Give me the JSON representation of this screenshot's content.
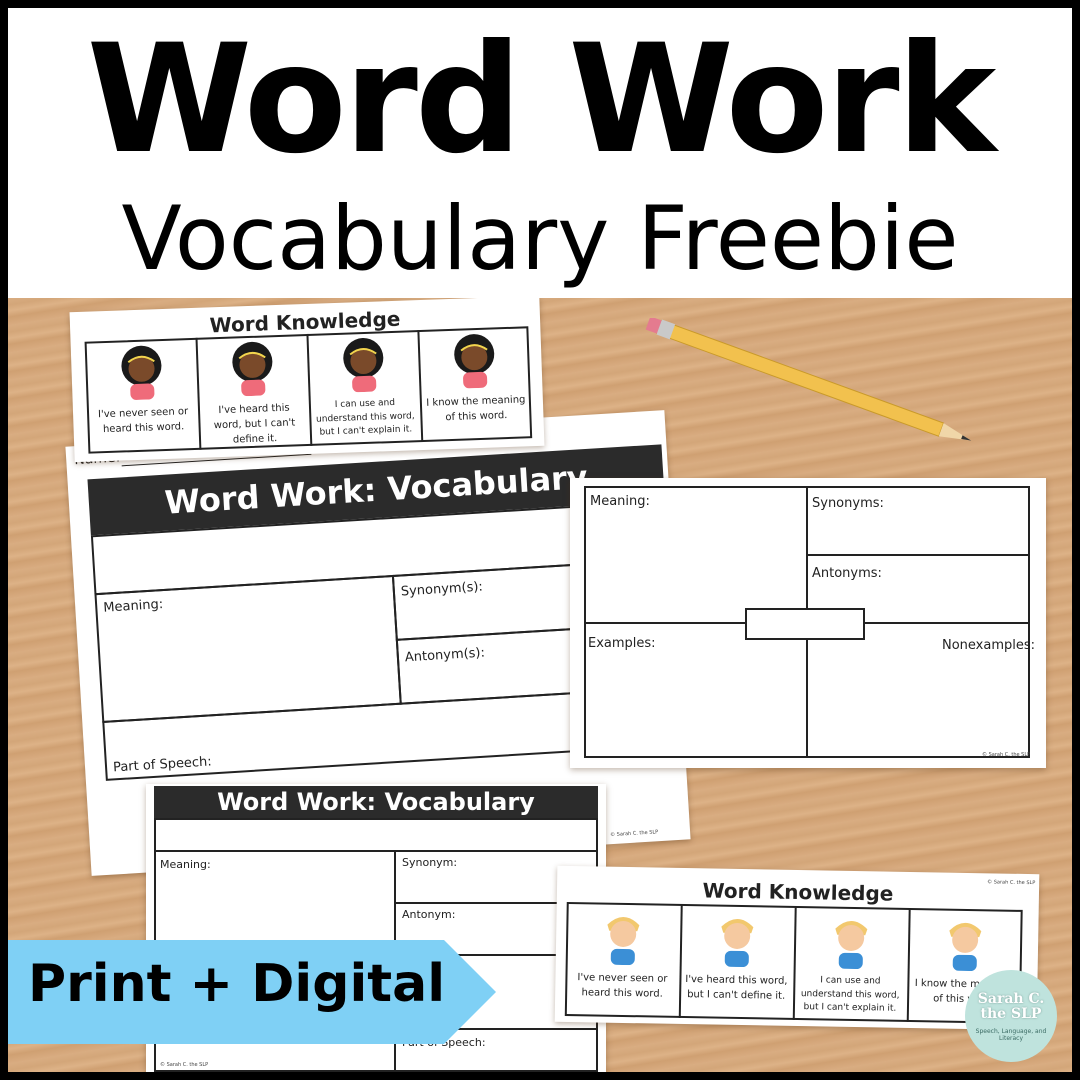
{
  "header": {
    "title": "Word Work",
    "subtitle": "Vocabulary Freebie"
  },
  "knowledge_card_top": {
    "title": "Word Knowledge",
    "captions": [
      "I've never seen or heard this word.",
      "I've heard this word, but I can't define it.",
      "I can use and understand this word, but I can't explain it.",
      "I know the meaning of this word."
    ]
  },
  "sheet_large": {
    "name_label": "Name:",
    "title": "Word Work: Vocabulary",
    "meaning": "Meaning:",
    "synonyms": "Synonym(s):",
    "antonyms": "Antonym(s):",
    "part_of_speech": "Part of Speech:",
    "credit": "© Sarah C. the SLP"
  },
  "frayer_sheet": {
    "meaning": "Meaning:",
    "synonyms": "Synonyms:",
    "antonyms": "Antonyms:",
    "examples": "Examples:",
    "nonexamples": "Nonexamples:",
    "credit": "© Sarah C. the SLP"
  },
  "sheet_small": {
    "title": "Word Work: Vocabulary",
    "meaning": "Meaning:",
    "synonym": "Synonym:",
    "antonym": "Antonym:",
    "part_of_speech": "Part of Speech:",
    "credit": "© Sarah C. the SLP"
  },
  "knowledge_card_bottom": {
    "title": "Word Knowledge",
    "credit": "© Sarah C. the SLP",
    "captions": [
      "I've never seen or heard this word.",
      "I've heard this word, but I can't define it.",
      "I can use and understand this word, but I can't explain it.",
      "I know the meaning of this word."
    ]
  },
  "badge": {
    "label": "Print + Digital",
    "color": "#7fd0f5"
  },
  "logo": {
    "name": "Sarah C. the SLP",
    "tagline": "Speech, Language, and Literacy"
  },
  "colors": {
    "wood": "#d6a97d",
    "header_bg": "#ffffff",
    "sheet_bar": "#2b2b2b",
    "girl_shirt": "#ef6b7a",
    "boy_shirt": "#3b8fd6",
    "pencil": "#f2c14e"
  },
  "icons": [
    "girl-face-icon",
    "boy-face-icon",
    "pencil-icon",
    "arrow-badge-icon"
  ]
}
